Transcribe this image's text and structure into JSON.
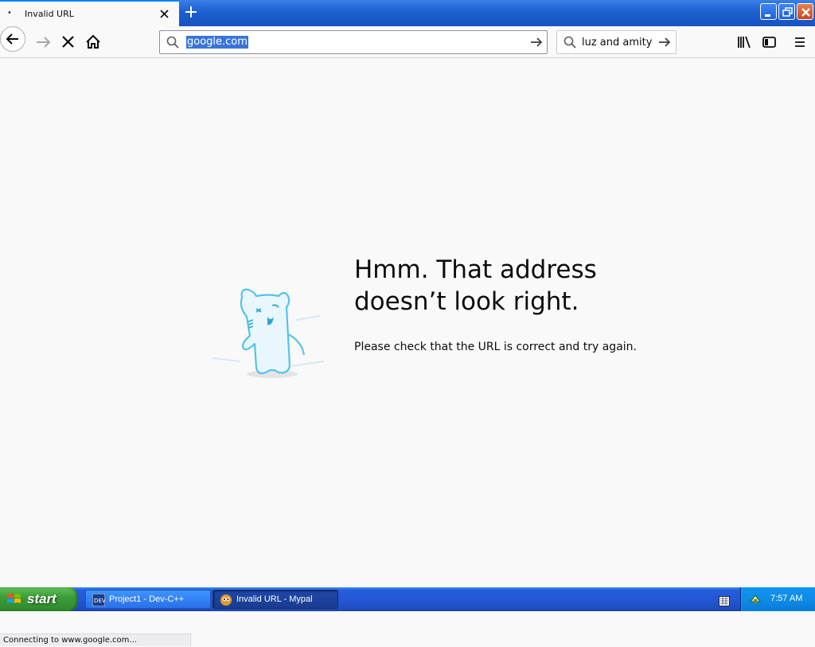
{
  "tab": {
    "title": "Invalid URL",
    "dot": "•"
  },
  "urlbar": {
    "value": "google.com"
  },
  "searchbar": {
    "value": "luz and amity"
  },
  "error": {
    "title": "Hmm. That address doesn’t look right.",
    "description": "Please check that the URL is correct and try again."
  },
  "status": {
    "text": "Connecting to www.google.com..."
  },
  "taskbar": {
    "start_label": "start",
    "tasks": [
      {
        "label": "Project1 - Dev-C++",
        "icon": "devcpp-icon"
      },
      {
        "label": "Invalid URL - Mypal",
        "icon": "mypal-icon",
        "active": true
      }
    ],
    "clock": "7:57 AM"
  },
  "colors": {
    "accent": "#0a84ff",
    "selection": "#3875d7",
    "taskbar": "#245edb",
    "start": "#3c9d39"
  }
}
